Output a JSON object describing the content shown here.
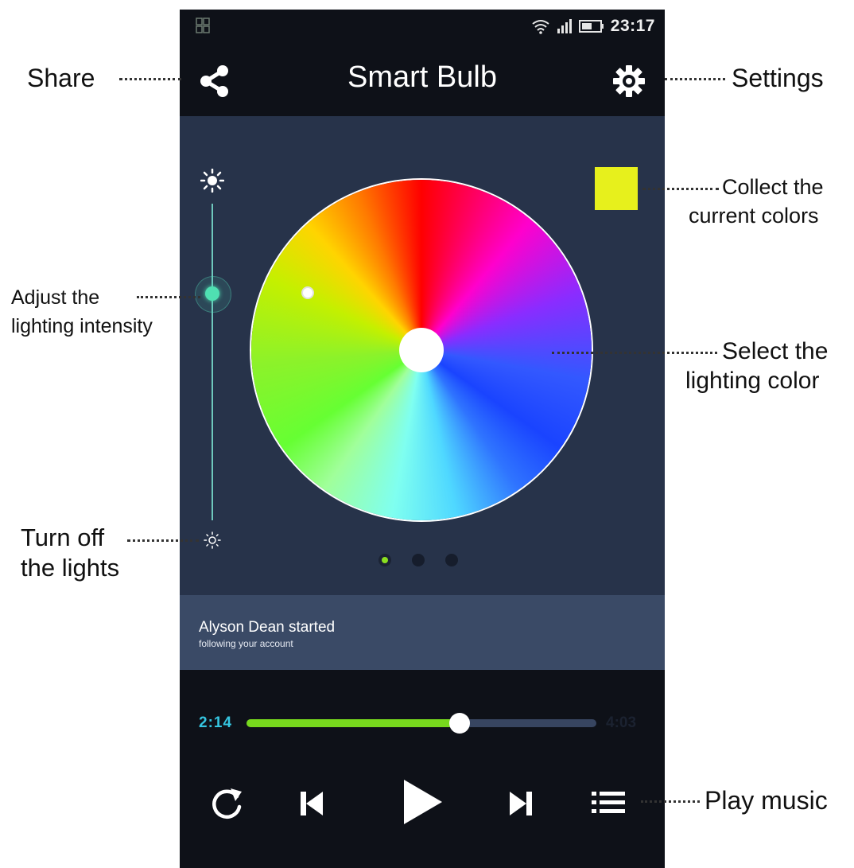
{
  "status_bar": {
    "time": "23:17"
  },
  "header": {
    "title": "Smart Bulb"
  },
  "brightness": {
    "level": 0.22
  },
  "color_wheel": {
    "selected_color": "#e7f01c"
  },
  "pager": {
    "active_index": 0,
    "count": 3
  },
  "notification": {
    "title": "Alyson Dean started",
    "subtitle": "following your account"
  },
  "player": {
    "current_time": "2:14",
    "total_time": "4:03",
    "progress": 0.61
  },
  "colors": {
    "accent_green": "#77d91d",
    "time_blue": "#35c5e0",
    "swatch": "#e7f01c"
  },
  "annotations": {
    "share": "Share",
    "settings": "Settings",
    "collect_line1": "Collect the",
    "collect_line2": "current colors",
    "adjust_line1": "Adjust the",
    "adjust_line2": "lighting intensity",
    "select_line1": "Select the",
    "select_line2": "lighting color",
    "turnoff_line1": "Turn off",
    "turnoff_line2": "the lights",
    "play": "Play music"
  }
}
